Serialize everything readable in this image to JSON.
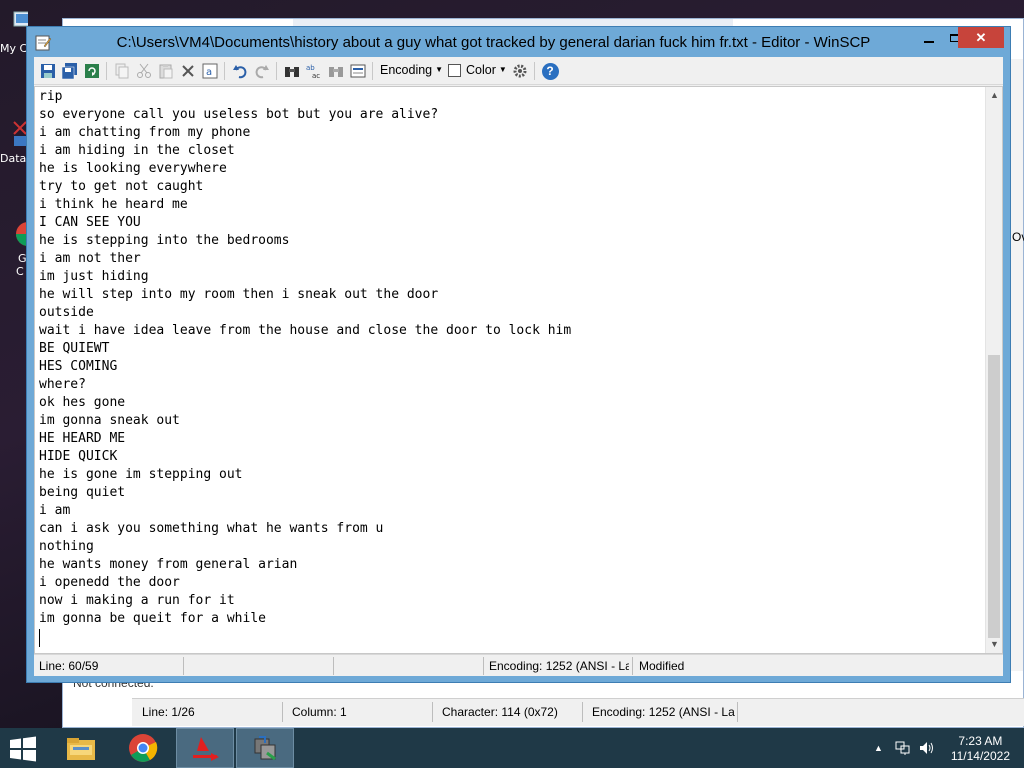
{
  "desktop": {
    "icons": [
      {
        "label": "My C"
      },
      {
        "label": "Data"
      },
      {
        "label": "G"
      },
      {
        "label": "C"
      }
    ],
    "bg_window": {
      "status_text": "Not connected.",
      "side_label": "Ov",
      "status_cells": [
        "Line: 1/26",
        "Column: 1",
        "Character: 114 (0x72)",
        "Encoding: 1252  (ANSI - La"
      ]
    }
  },
  "window": {
    "title": "C:\\Users\\VM4\\Documents\\history about a guy what got tracked by general darian fuck him fr.txt - Editor - WinSCP",
    "close_glyph": "✕",
    "accent_color": "#6ea9d7",
    "close_color": "#c7443b"
  },
  "toolbar": {
    "encoding_label": "Encoding",
    "color_label": "Color",
    "help_glyph": "?"
  },
  "editor": {
    "lines": [
      "rip",
      "so everyone call you useless bot but you are alive?",
      "i am chatting from my phone",
      "i am hiding in the closet",
      "he is looking everywhere",
      "try to get not caught",
      "i think he heard me",
      "I CAN SEE YOU",
      "he is stepping into the bedrooms",
      "i am not ther",
      "im just hiding",
      "he will step into my room then i sneak out the door",
      "outside",
      "wait i have idea leave from the house and close the door to lock him",
      "BE QUIEWT",
      "HES COMING",
      "where?",
      "ok hes gone",
      "im gonna sneak out",
      "HE HEARD ME",
      "HIDE QUICK",
      "he is gone im stepping out",
      "being quiet",
      "i am",
      "can i ask you something what he wants from u",
      "nothing",
      "he wants money from general arian",
      "i openedd the door",
      "now i making a run for it",
      "im gonna be queit for a while"
    ],
    "scroll_position": 0.5
  },
  "statusbar": {
    "line": "Line: 60/59",
    "encoding": "Encoding: 1252  (ANSI - La",
    "modified": "Modified"
  },
  "taskbar": {
    "time": "7:23 AM",
    "date": "11/14/2022"
  }
}
